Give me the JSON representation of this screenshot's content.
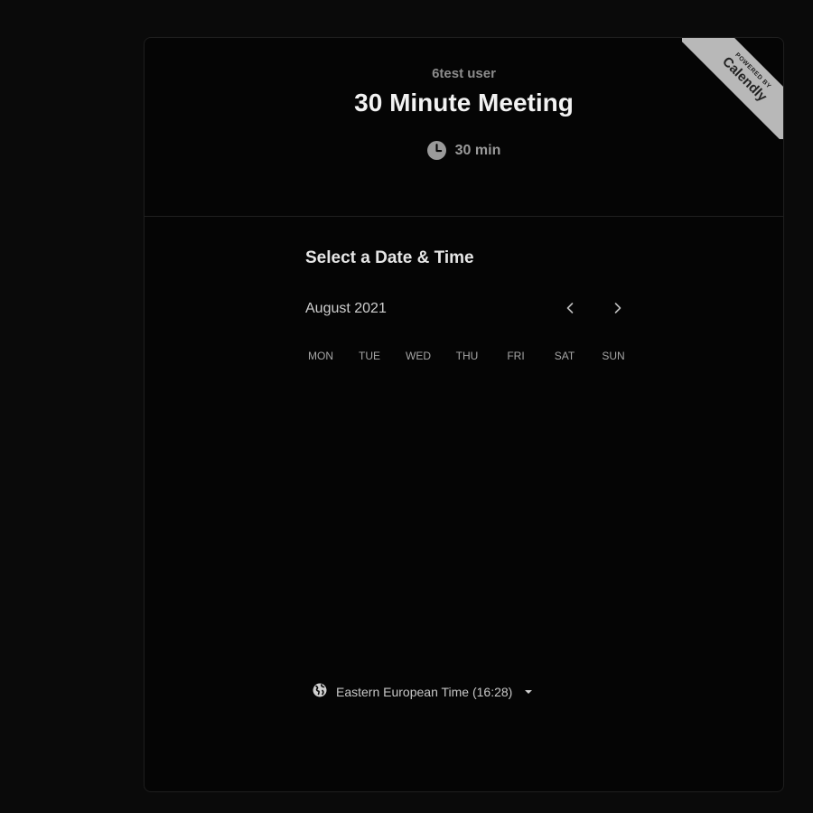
{
  "header": {
    "organizer": "6test user",
    "event_title": "30 Minute Meeting",
    "duration": "30 min",
    "duration_icon": "clock-icon"
  },
  "badge": {
    "powered_by": "POWERED BY",
    "brand": "Calendly"
  },
  "calendar": {
    "section_title": "Select a Date & Time",
    "month": "August 2021",
    "prev_icon": "chevron-left-icon",
    "next_icon": "chevron-right-icon",
    "weekdays": [
      "MON",
      "TUE",
      "WED",
      "THU",
      "FRI",
      "SAT",
      "SUN"
    ]
  },
  "timezone": {
    "icon": "globe-icon",
    "label": "Eastern European Time (16:28)"
  },
  "colors": {
    "background": "#0a0a0a",
    "card": "#050505",
    "ribbon": "#b8b8b8"
  }
}
